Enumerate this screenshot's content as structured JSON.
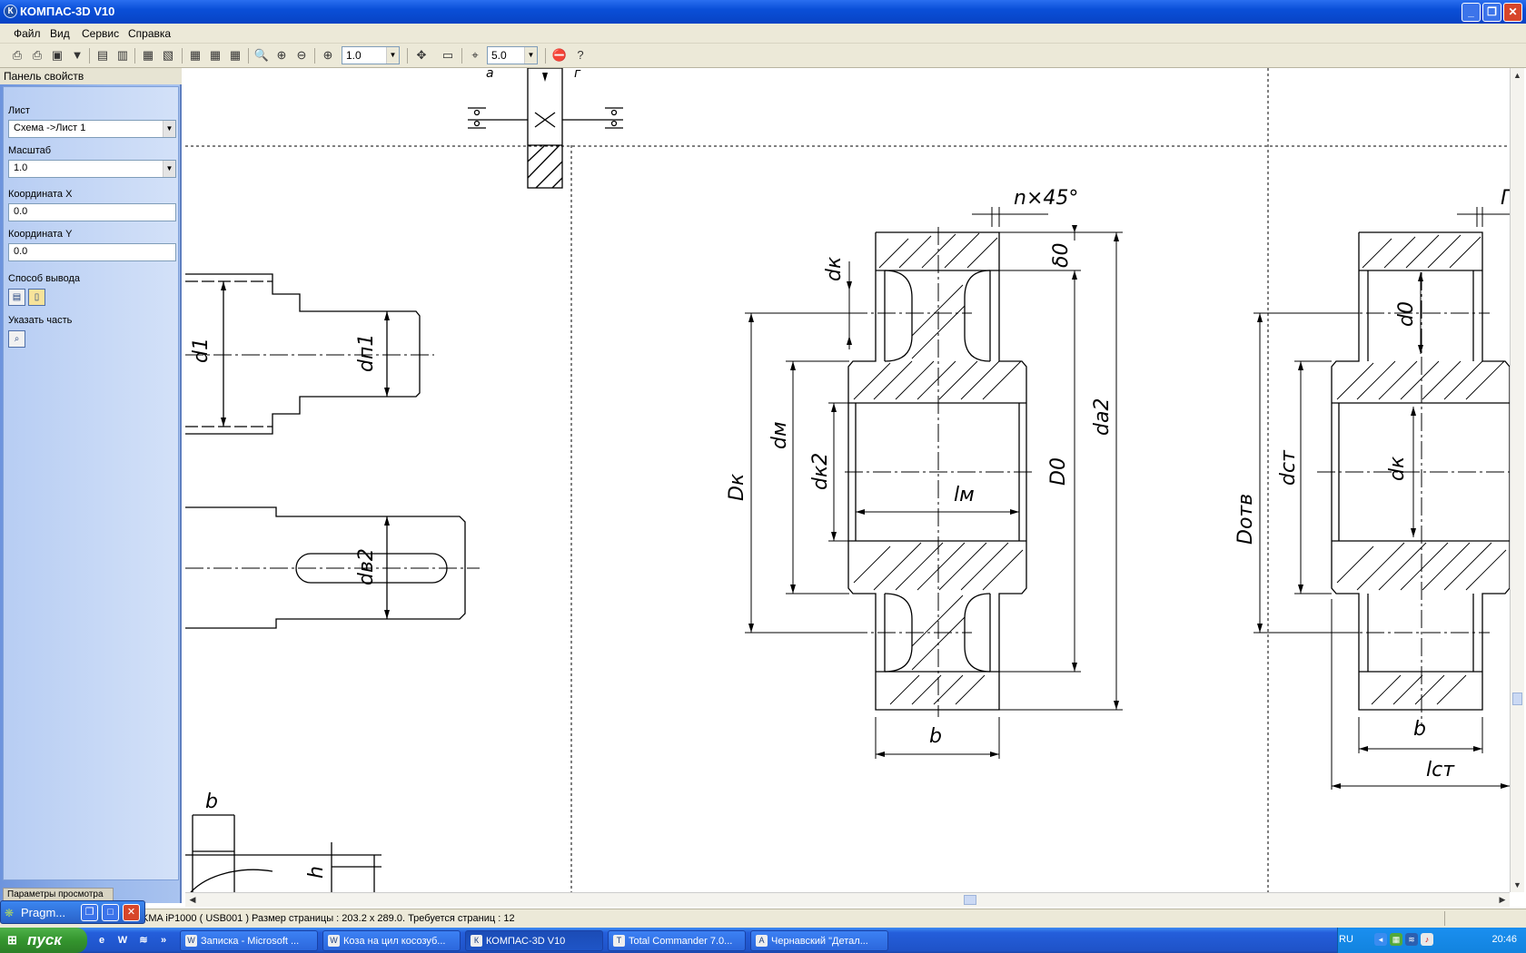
{
  "window": {
    "title": "КОМПАС-3D V10",
    "app_icon": "К"
  },
  "menu": [
    "Файл",
    "Вид",
    "Сервис",
    "Справка"
  ],
  "toolbar": {
    "zoom_value": "1.0",
    "step_value": "5.0"
  },
  "panel": {
    "title": "Панель свойств",
    "sheet_label": "Лист",
    "sheet_value": "Схема ->Лист 1",
    "scale_label": "Масштаб",
    "scale_value": "1.0",
    "coordx_label": "Координата X",
    "coordx_value": "0.0",
    "coordy_label": "Координата Y",
    "coordy_value": "0.0",
    "output_label": "Способ вывода",
    "part_label": "Указать часть",
    "bottom_tab": "Параметры просмотра"
  },
  "drawing": {
    "gear_labels": {
      "chamfer": "n×45°",
      "dk": "dк",
      "delta0": "δ0",
      "dm": "dм",
      "dk2": "dк2",
      "Dk": "Dк",
      "lm": "lм",
      "D0": "D0",
      "da2": "da2",
      "b": "b"
    },
    "wheel_labels": {
      "d0": "d0",
      "dk": "dк",
      "dst": "dст",
      "Dotv": "Dотв",
      "b": "b",
      "lst": "lст",
      "chamfer_partial": "n",
      "Г": "Г"
    },
    "shaft_labels": {
      "d1": "d1",
      "dn1": "dп1",
      "dv2": "dв2"
    },
    "key_labels": {
      "b": "b",
      "h": "h"
    },
    "top_labels": {
      "a": "a",
      "g": "г"
    }
  },
  "statusbar": {
    "text": "KMA iP1000 ( USB001 )  Размер страницы : 203.2 x 289.0.  Требуется страниц : 12"
  },
  "mini_window": {
    "label": "Pragm..."
  },
  "taskbar": {
    "start_label": "пуск",
    "tasks": [
      {
        "label": "Записка - Microsoft ...",
        "icon": "W"
      },
      {
        "label": "Коза на цил косозуб...",
        "icon": "W"
      },
      {
        "label": "КОМПАС-3D V10",
        "icon": "К"
      },
      {
        "label": "Total Commander 7.0...",
        "icon": "T"
      },
      {
        "label": "Чернавский \"Детал...",
        "icon": "A"
      }
    ],
    "lang": "RU",
    "clock": "20:46"
  }
}
